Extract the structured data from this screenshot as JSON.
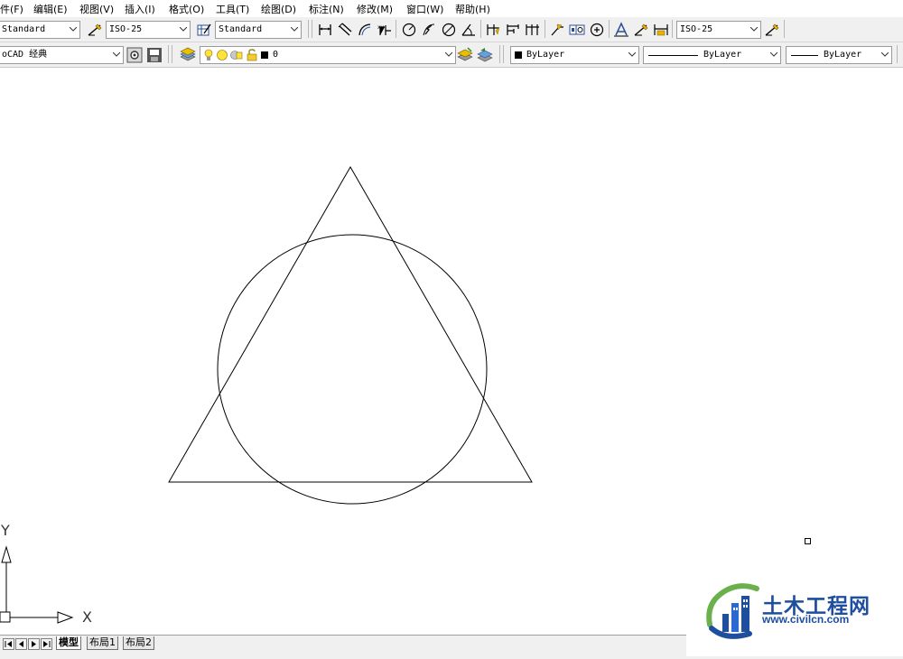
{
  "menubar": {
    "items": [
      "件(F)",
      "编辑(E)",
      "视图(V)",
      "插入(I)",
      "格式(O)",
      "工具(T)",
      "绘图(D)",
      "标注(N)",
      "修改(M)",
      "窗口(W)",
      "帮助(H)"
    ]
  },
  "styles_toolbar": {
    "text_style": "Standard",
    "dim_style": "ISO-25",
    "table_style": "Standard",
    "dim_style_right": "ISO-25"
  },
  "workspace_toolbar": {
    "workspace": "oCAD 经典",
    "layer": "0",
    "color": "ByLayer",
    "linetype": "ByLayer",
    "lineweight": "ByLayer"
  },
  "ucs": {
    "x_label": "X",
    "y_label": "Y"
  },
  "layout_tabs": [
    "模型",
    "布局1",
    "布局2"
  ],
  "watermark": {
    "title": "土木工程网",
    "url": "www.civilcn.com"
  },
  "colors": {
    "toolbar_bg": "#f0f0f0",
    "brand_blue": "#1e4e9e",
    "brand_green": "#6ab04c"
  }
}
